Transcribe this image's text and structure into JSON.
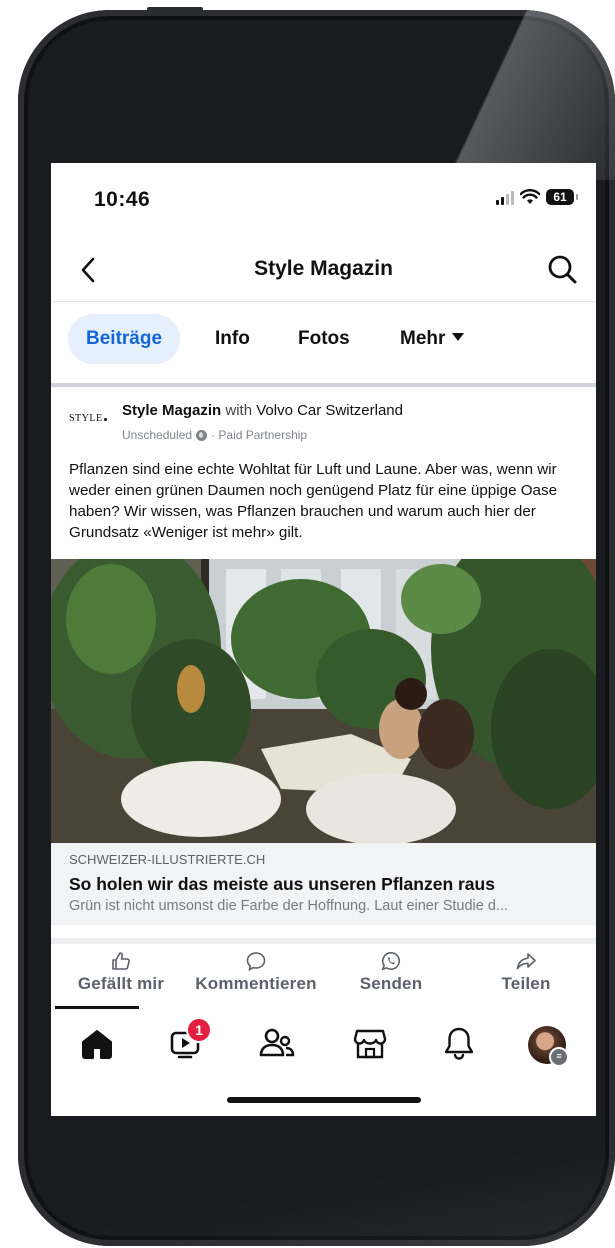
{
  "status": {
    "time": "10:46",
    "battery": "61"
  },
  "nav": {
    "title": "Style Magazin",
    "back_icon": "chevron-left-icon",
    "search_icon": "search-icon"
  },
  "tabs": [
    {
      "label": "Beiträge",
      "active": true
    },
    {
      "label": "Info",
      "active": false
    },
    {
      "label": "Fotos",
      "active": false
    },
    {
      "label": "Mehr",
      "active": false
    }
  ],
  "post": {
    "logo_text": "STYLE",
    "author": "Style Magazin",
    "with_word": "with",
    "partner": "Volvo Car Switzerland",
    "status_label": "Unscheduled",
    "partnership": "· Paid Partnership",
    "text": "Pflanzen sind eine echte Wohltat für Luft und Laune. Aber was, wenn wir weder einen grünen Daumen noch genügend Platz für eine üppige Oase haben? Wir wissen, was Pflanzen brauchen und warum auch hier der Grundsatz «Weniger ist mehr» gilt.",
    "link": {
      "domain": "SCHWEIZER-ILLUSTRIERTE.CH",
      "title": "So holen wir das meiste aus unseren Pflanzen raus",
      "description": "Grün ist nicht umsonst die Farbe der Hoffnung. Laut einer Studie d..."
    }
  },
  "actions": [
    {
      "label": "Gefällt mir",
      "icon": "thumbs-up-icon"
    },
    {
      "label": "Kommentieren",
      "icon": "comment-icon"
    },
    {
      "label": "Senden",
      "icon": "whatsapp-icon"
    },
    {
      "label": "Teilen",
      "icon": "share-icon"
    }
  ],
  "bottom_nav": {
    "video_badge": "1",
    "items": [
      "home-icon",
      "video-icon",
      "friends-icon",
      "marketplace-icon",
      "bell-icon",
      "profile-avatar"
    ]
  },
  "colors": {
    "accent": "#1466d8",
    "badge": "#e41e3f",
    "tab_active_bg": "#e6f0fd"
  }
}
